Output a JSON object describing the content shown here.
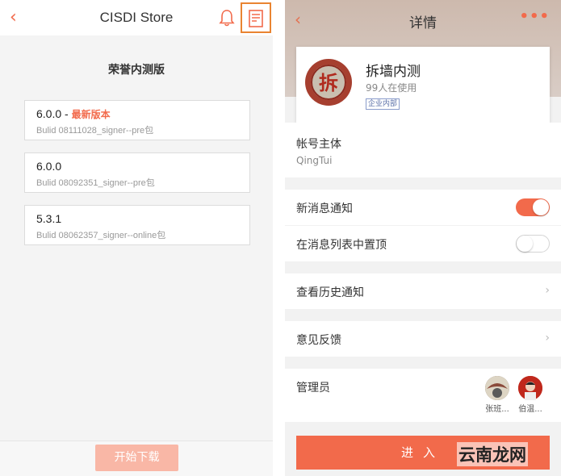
{
  "left": {
    "title": "CISDI Store",
    "section_title": "荣誉内测版",
    "versions": [
      {
        "version": "6.0.0",
        "sep": " - ",
        "latest_label": "最新版本",
        "build": "Bulid 08111028_signer--pre包"
      },
      {
        "version": "6.0.0",
        "sep": "",
        "latest_label": "",
        "build": "Bulid 08092351_signer--pre包"
      },
      {
        "version": "5.3.1",
        "sep": "",
        "latest_label": "",
        "build": "Bulid 08062357_signer--online包"
      }
    ],
    "download_label": "开始下载"
  },
  "right": {
    "title": "详情",
    "more_label": "•••",
    "app_name": "拆墙内测",
    "app_users": "99人在使用",
    "app_badge": "企业内部",
    "logo_char": "拆",
    "account_label": "帐号主体",
    "account_value": "QingTui",
    "new_msg_label": "新消息通知",
    "new_msg_on": true,
    "pin_label": "在消息列表中置顶",
    "pin_on": false,
    "history_label": "查看历史通知",
    "feedback_label": "意见反馈",
    "admin_label": "管理员",
    "admins": [
      {
        "name": "张班..."
      },
      {
        "name": "伯温..."
      }
    ],
    "enter_label": "进入",
    "watermark": "云南龙网"
  },
  "colors": {
    "accent": "#f26a4b",
    "highlight_border": "#e98431"
  }
}
